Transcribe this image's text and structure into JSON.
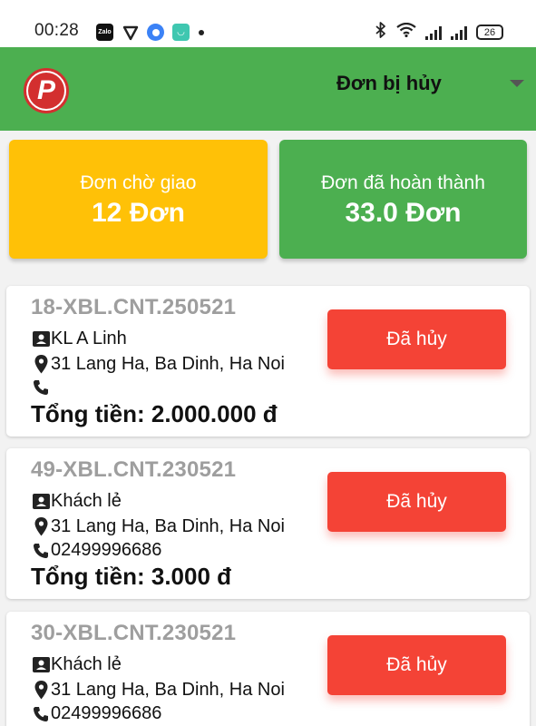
{
  "status_bar": {
    "time": "00:28",
    "app_icons": [
      "zalo-icon",
      "shield-icon",
      "chrome-icon",
      "mi-icon"
    ],
    "battery": "26"
  },
  "header": {
    "logo": "app-logo",
    "filter_selected": "Đơn bị hủy"
  },
  "stats": {
    "pending_label": "Đơn chờ giao",
    "pending_value": "12 Đơn",
    "done_label": "Đơn đã hoàn thành",
    "done_value": "33.0 Đơn"
  },
  "colors": {
    "primary": "#4caf50",
    "pending": "#ffc107",
    "cancel": "#f44336",
    "code": "#9e9e9e"
  },
  "orders": [
    {
      "code": "18-XBL.CNT.250521",
      "customer": "KL A Linh",
      "address": "31 Lang Ha, Ba Dinh, Ha Noi",
      "phone": "",
      "total": "Tổng tiền: 2.000.000 đ",
      "status": "Đã hủy"
    },
    {
      "code": "49-XBL.CNT.230521",
      "customer": "Khách lẻ",
      "address": "31 Lang Ha, Ba Dinh, Ha Noi",
      "phone": "02499996686",
      "total": "Tổng tiền: 3.000 đ",
      "status": "Đã hủy"
    },
    {
      "code": "30-XBL.CNT.230521",
      "customer": "Khách lẻ",
      "address": "31 Lang Ha, Ba Dinh, Ha Noi",
      "phone": "02499996686",
      "total": "",
      "status": "Đã hủy"
    }
  ]
}
